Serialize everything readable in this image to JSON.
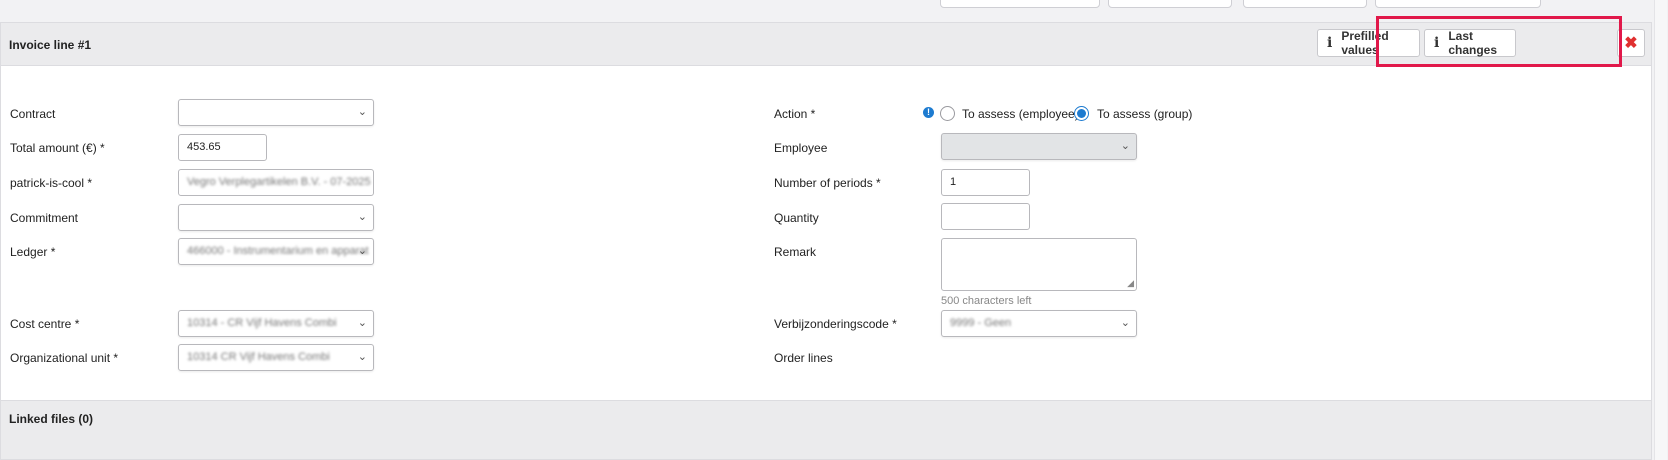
{
  "panel": {
    "title": "Invoice line #1",
    "prefilled_label": "Prefilled values",
    "last_changes_label": "Last changes",
    "delete_symbol": "✖"
  },
  "form_left": {
    "contract": {
      "label": "Contract",
      "value": ""
    },
    "total_amount": {
      "label": "Total amount (€) *",
      "value": "453.65"
    },
    "patrick": {
      "label": "patrick-is-cool *",
      "value": "Vegro Verplegartikelen B.V. - 07-2025"
    },
    "commitment": {
      "label": "Commitment",
      "value": ""
    },
    "ledger": {
      "label": "Ledger *",
      "value": "466000 - Instrumentarium en apparat"
    },
    "cost_centre": {
      "label": "Cost centre *",
      "value": "10314 - CR Vijf Havens Combi"
    },
    "org_unit": {
      "label": "Organizational unit *",
      "value": "10314 CR Vijf Havens Combi"
    }
  },
  "form_right": {
    "action": {
      "label": "Action *",
      "options": [
        "To assess (employee)",
        "To assess (group)"
      ],
      "selected": "To assess (group)"
    },
    "employee": {
      "label": "Employee",
      "value": ""
    },
    "periods": {
      "label": "Number of periods *",
      "value": "1"
    },
    "quantity": {
      "label": "Quantity",
      "value": ""
    },
    "remark": {
      "label": "Remark",
      "value": "",
      "hint": "500 characters left"
    },
    "verbijzondering": {
      "label": "Verbijzonderingscode *",
      "value": "9999 - Geen"
    },
    "order_lines": {
      "label": "Order lines"
    }
  },
  "linked_files": {
    "title": "Linked files (0)"
  },
  "colors": {
    "accent": "#1d7bd0",
    "highlight": "#e1184a",
    "delete": "#e03030"
  },
  "icons": {
    "info": "info-icon",
    "chevron": "chevron-down-icon",
    "close": "close-icon"
  }
}
